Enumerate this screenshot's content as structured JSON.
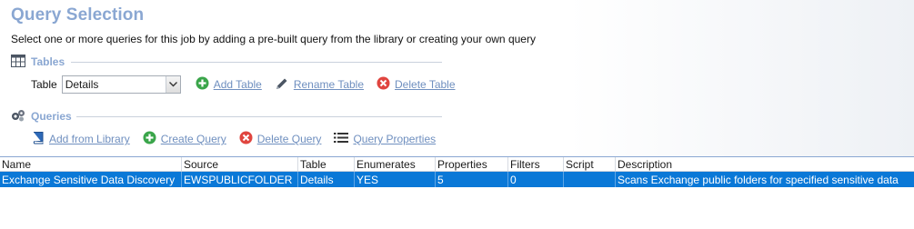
{
  "header": {
    "title": "Query Selection",
    "subtitle": "Select one or more queries for this job by adding a pre-built query from the library or creating your own query"
  },
  "tables_section": {
    "heading": "Tables",
    "table_label": "Table",
    "selected_table": "Details",
    "actions": {
      "add": "Add Table",
      "rename": "Rename Table",
      "delete": "Delete Table"
    }
  },
  "queries_section": {
    "heading": "Queries",
    "actions": {
      "add_from_library": "Add from Library",
      "create": "Create Query",
      "delete": "Delete Query",
      "properties": "Query Properties"
    }
  },
  "grid": {
    "columns": {
      "name": "Name",
      "source": "Source",
      "table": "Table",
      "enumerates": "Enumerates",
      "properties": "Properties",
      "filters": "Filters",
      "script": "Script",
      "description": "Description"
    },
    "rows": [
      {
        "name": "Exchange Sensitive Data Discovery",
        "source": "EWSPUBLICFOLDER",
        "table": "Details",
        "enumerates": "YES",
        "properties": "5",
        "filters": "0",
        "script": "",
        "description": "Scans Exchange public folders for specified sensitive data"
      }
    ]
  },
  "colors": {
    "accent": "#8aa7d2",
    "link": "#6f8fbf",
    "selection": "#0a78d7",
    "add_green": "#3aa54a",
    "delete_red": "#e0453f"
  }
}
